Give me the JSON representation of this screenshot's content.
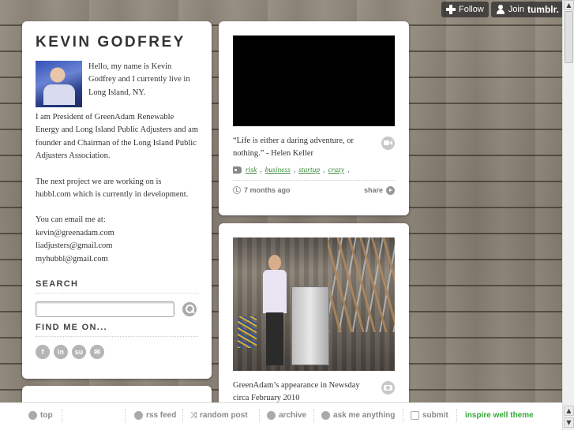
{
  "tumblr_bar": {
    "follow_label": "Follow",
    "join_prefix": "Join",
    "join_brand": "tumblr."
  },
  "sidebar": {
    "site_title": "KEVIN GODFREY",
    "intro": "Hello, my name is Kevin Godfrey and I currently live in Long Island, NY.",
    "bio_paragraph_1": "I am President of GreenAdam Renewable Energy and Long Island Public Adjusters and am founder and Chairman of the Long Island Public Adjusters Association.",
    "bio_paragraph_2": "The next project we are working on is hubbl.com which is currently in development.",
    "email_intro": "You can email me at:",
    "emails": [
      "kevin@greenadam.com",
      "liadjusters@gmail.com",
      "myhubbl@gmail.com"
    ],
    "search_heading": "SEARCH",
    "search_placeholder": "",
    "find_me_heading": "FIND ME ON...",
    "social_icons": [
      {
        "name": "facebook-icon",
        "glyph": "f"
      },
      {
        "name": "linkedin-icon",
        "glyph": "in"
      },
      {
        "name": "stumbleupon-icon",
        "glyph": "su"
      },
      {
        "name": "email-icon",
        "glyph": "✉"
      }
    ]
  },
  "posts": [
    {
      "type": "video",
      "caption": "“Life is either a daring adventure, or nothing.” - Helen Keller",
      "tags": [
        "risk",
        "business",
        "startup",
        "crazy"
      ],
      "time_ago": "7 months ago",
      "share_label": "share"
    },
    {
      "type": "photo",
      "caption": "GreenAdam’s appearance in Newsday circa February 2010"
    }
  ],
  "bottom_nav": {
    "top_label": "top",
    "rss_label": "rss feed",
    "random_label": "random post",
    "archive_label": "archive",
    "ask_label": "ask me anything",
    "submit_label": "submit",
    "theme_label": "inspire well theme"
  },
  "colors": {
    "tag_link": "#3a8a3a",
    "theme_link": "#36a836",
    "background_wood": "#8d8478"
  }
}
